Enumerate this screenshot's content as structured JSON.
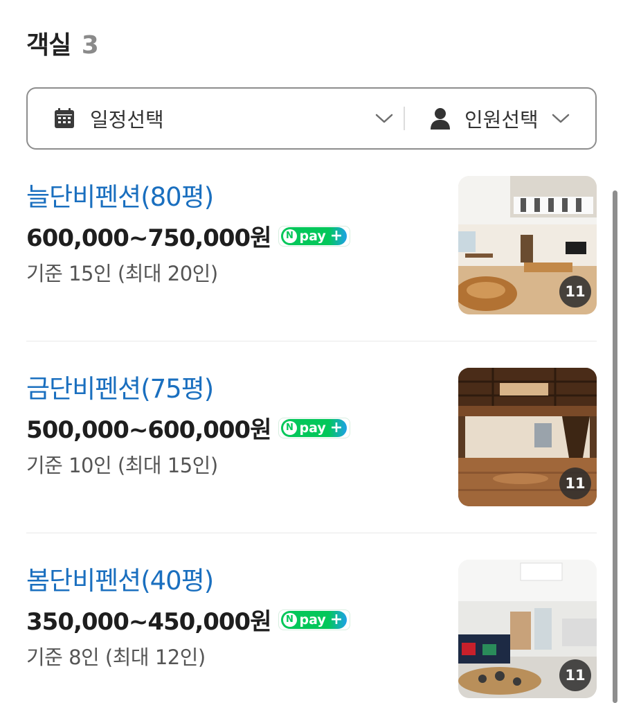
{
  "section": {
    "title": "객실",
    "count": "3"
  },
  "filter": {
    "date_label": "일정선택",
    "person_label": "인원선택"
  },
  "npay": {
    "label": "pay"
  },
  "rooms": [
    {
      "name": "늘단비펜션(80평)",
      "price": "600,000~750,000원",
      "capacity": "기준 15인 (최대 20인)",
      "photo_count": "11"
    },
    {
      "name": "금단비펜션(75평)",
      "price": "500,000~600,000원",
      "capacity": "기준 10인 (최대 15인)",
      "photo_count": "11"
    },
    {
      "name": "봄단비펜션(40평)",
      "price": "350,000~450,000원",
      "capacity": "기준 8인 (최대 12인)",
      "photo_count": "11"
    }
  ],
  "colors": {
    "room_name": "#1a6fbf",
    "npay_green": "#03c75a",
    "npay_blue": "#1ea1e8",
    "border": "#8d8d8d"
  }
}
